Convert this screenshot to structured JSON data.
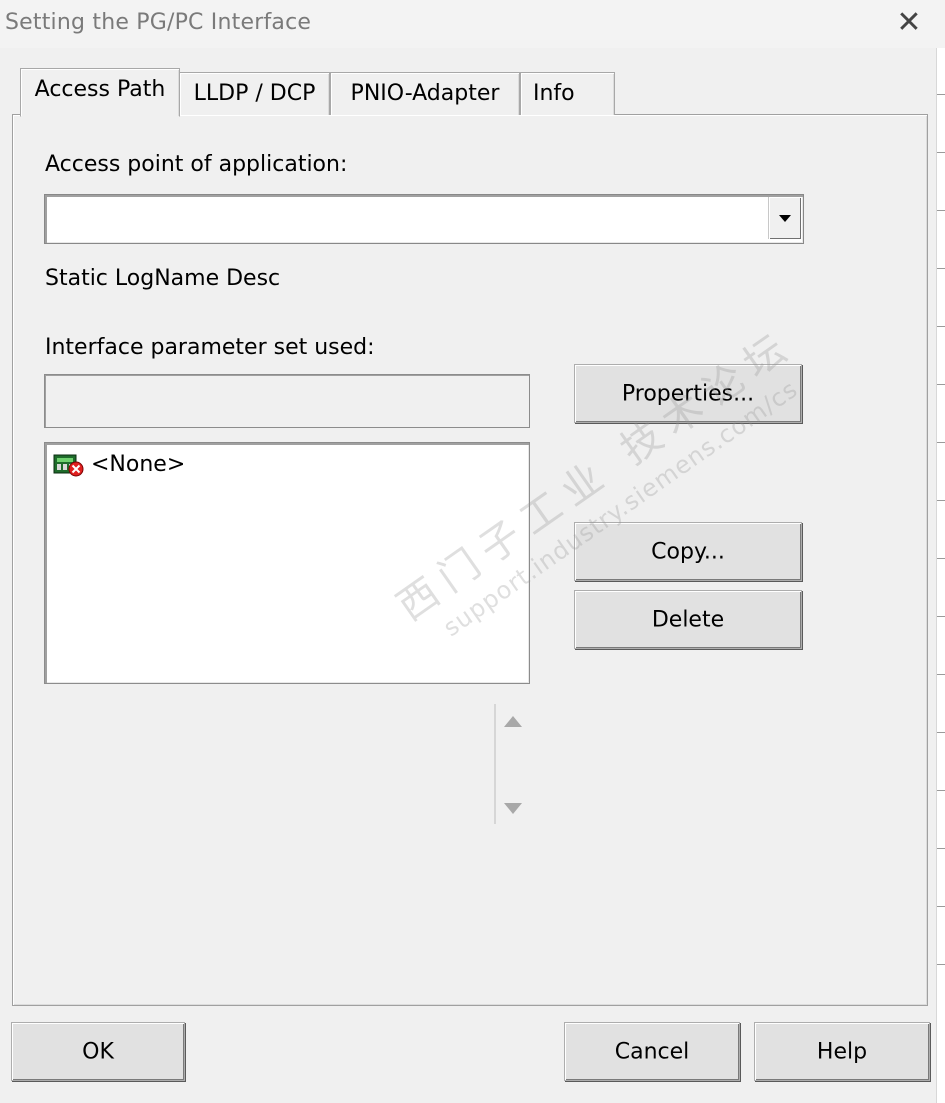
{
  "window": {
    "title": "Setting the PG/PC Interface",
    "close_glyph": "✕"
  },
  "tabs": [
    {
      "label": "Access Path",
      "active": true
    },
    {
      "label": "LLDP / DCP",
      "active": false
    },
    {
      "label": "PNIO-Adapter",
      "active": false
    },
    {
      "label": "Info",
      "active": false
    }
  ],
  "access_point": {
    "label": "Access point of application:",
    "value": ""
  },
  "static_desc": "Static LogName Desc",
  "param_set": {
    "label": "Interface parameter set used:",
    "value": "",
    "items": [
      {
        "text": "<None>",
        "icon": "network-adapter-error-icon"
      }
    ]
  },
  "buttons": {
    "properties": "Properties...",
    "copy": "Copy...",
    "delete": "Delete",
    "ok": "OK",
    "cancel": "Cancel",
    "help": "Help"
  },
  "watermark": {
    "line1": "西门子工业 技术论坛",
    "line2": "support.industry.siemens.com/cs"
  }
}
